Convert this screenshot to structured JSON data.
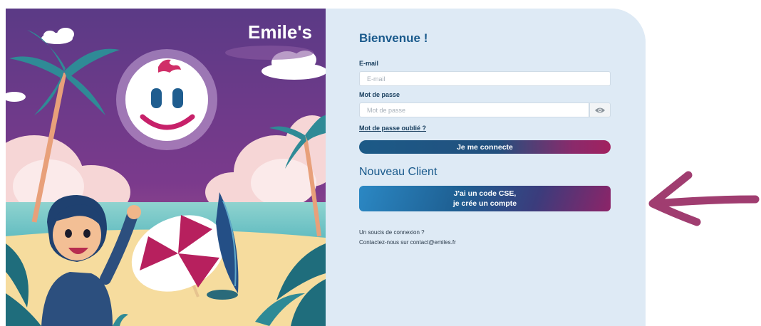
{
  "brand": {
    "logo_text": "Emile's"
  },
  "login": {
    "welcome": "Bienvenue !",
    "email_label": "E-mail",
    "email_placeholder": "E-mail",
    "email_value": "",
    "password_label": "Mot de passe",
    "password_placeholder": "Mot de passe",
    "password_value": "",
    "forgot_link": "Mot de passe oublié ?",
    "connect_button": "Je me connecte"
  },
  "new_client": {
    "title": "Nouveau Client",
    "cse_button_line1": "J'ai un code CSE,",
    "cse_button_line2": "je crée un compte"
  },
  "help": {
    "line1": "Un soucis de connexion ?",
    "line2": "Contactez-nous sur contact@emiles.fr"
  },
  "colors": {
    "panel_bg": "#deeaf5",
    "heading": "#1a5a8c",
    "accent_magenta": "#a2215f",
    "arrow": "#a03d70",
    "sky": "#6d3585"
  },
  "icons": [
    "eye-icon",
    "arrow-left-icon"
  ]
}
